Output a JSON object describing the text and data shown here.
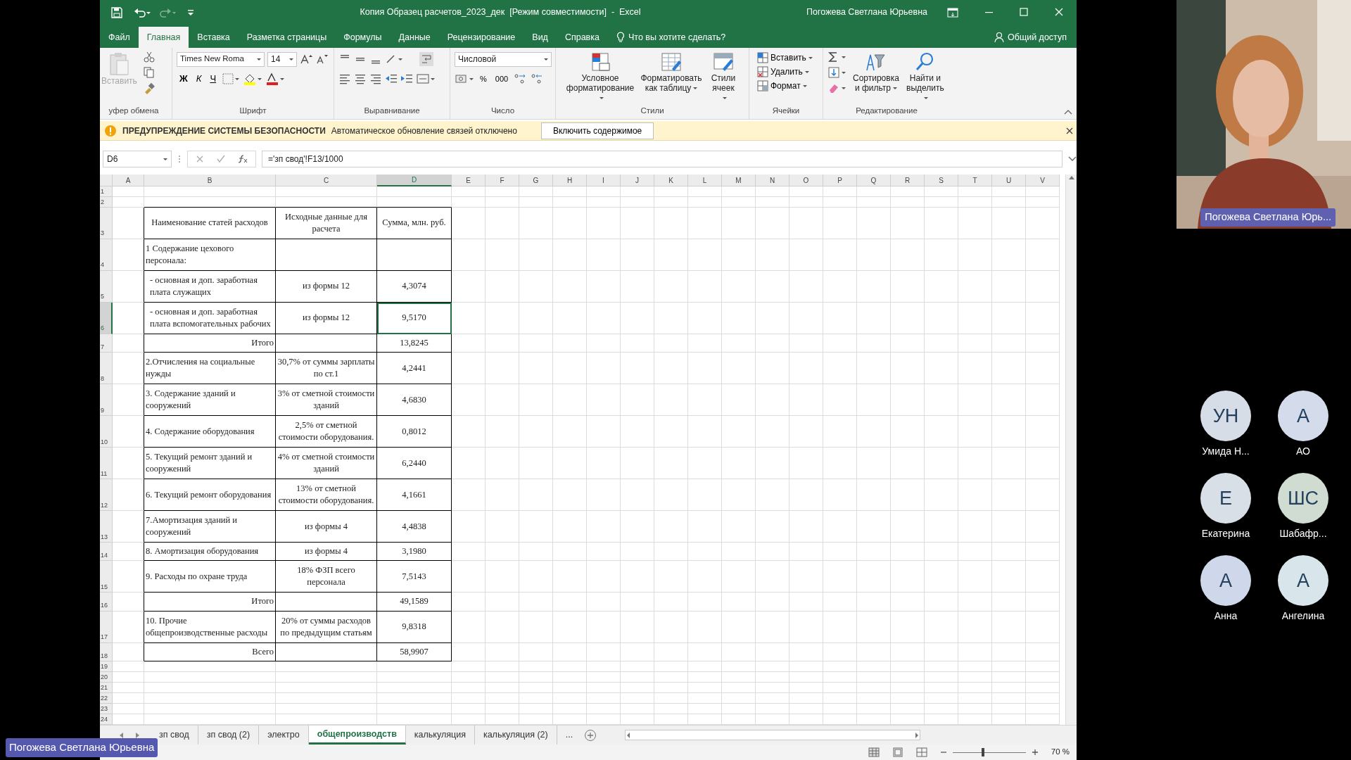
{
  "title_bar": {
    "title": "Копия Образец расчетов_2023_дек  [Режим совместимости]  -  Excel",
    "user": "Погожева Светлана Юрьевна"
  },
  "menu_tabs": [
    {
      "label": "Файл",
      "selected": false
    },
    {
      "label": "Главная",
      "selected": true
    },
    {
      "label": "Вставка",
      "selected": false
    },
    {
      "label": "Разметка страницы",
      "selected": false
    },
    {
      "label": "Формулы",
      "selected": false
    },
    {
      "label": "Данные",
      "selected": false
    },
    {
      "label": "Рецензирование",
      "selected": false
    },
    {
      "label": "Вид",
      "selected": false
    },
    {
      "label": "Справка",
      "selected": false
    }
  ],
  "tell_me": "Что вы хотите сделать?",
  "share": "Общий доступ",
  "ribbon": {
    "groups": [
      {
        "kind": "clipboard",
        "label": "уфер обмена",
        "paste": {
          "label": "Вставить",
          "disabled": true
        }
      },
      {
        "kind": "font",
        "label": "Шрифт",
        "font_name": "Times New Roma",
        "font_size": "14",
        "style_buttons": [
          {
            "label": "Ж",
            "kind": "bold"
          },
          {
            "label": "К",
            "kind": "italic"
          },
          {
            "label": "Ч",
            "kind": "underline"
          }
        ]
      },
      {
        "kind": "alignment",
        "label": "Выравнивание"
      },
      {
        "kind": "number",
        "label": "Число",
        "format": "Числовой",
        "buttons": [
          "%",
          "000"
        ]
      },
      {
        "kind": "styles",
        "label": "Стили",
        "buttons": [
          "Условное форматирование",
          "Форматировать как таблицу",
          "Стили ячеек"
        ]
      },
      {
        "kind": "cells",
        "label": "Ячейки",
        "buttons": [
          "Вставить",
          "Удалить",
          "Формат"
        ]
      },
      {
        "kind": "editing",
        "label": "Редактирование",
        "buttons": [
          "Сортировка и фильтр",
          "Найти и выделить"
        ]
      }
    ]
  },
  "security_bar": {
    "title": "ПРЕДУПРЕЖДЕНИЕ СИСТЕМЫ БЕЗОПАСНОСТИ",
    "message": "Автоматическое обновление связей отключено",
    "button": "Включить содержимое"
  },
  "formula_bar": {
    "name_box": "D6",
    "formula": "='зп свод'!F13/1000"
  },
  "sheet": {
    "columns": [
      {
        "label": "A",
        "selected": false
      },
      {
        "label": "B",
        "selected": false
      },
      {
        "label": "C",
        "selected": false
      },
      {
        "label": "D",
        "selected": true
      },
      {
        "label": "E",
        "selected": false
      },
      {
        "label": "F",
        "selected": false
      },
      {
        "label": "G",
        "selected": false
      },
      {
        "label": "H",
        "selected": false
      },
      {
        "label": "I",
        "selected": false
      },
      {
        "label": "J",
        "selected": false
      },
      {
        "label": "K",
        "selected": false
      },
      {
        "label": "L",
        "selected": false
      },
      {
        "label": "M",
        "selected": false
      },
      {
        "label": "N",
        "selected": false
      },
      {
        "label": "O",
        "selected": false
      },
      {
        "label": "P",
        "selected": false
      },
      {
        "label": "Q",
        "selected": false
      },
      {
        "label": "R",
        "selected": false
      },
      {
        "label": "S",
        "selected": false
      },
      {
        "label": "T",
        "selected": false
      },
      {
        "label": "U",
        "selected": false
      },
      {
        "label": "V",
        "selected": false
      }
    ],
    "rows": [
      {
        "number": "1",
        "selected": false,
        "kind": "empty"
      },
      {
        "number": "2",
        "selected": false,
        "kind": "empty"
      },
      {
        "number": "3",
        "selected": false,
        "kind": "header",
        "name": "Наименование статей расходов",
        "source": "Исходные данные для расчета",
        "amount": "Сумма, млн. руб."
      },
      {
        "number": "4",
        "selected": false,
        "kind": "item",
        "name": "1 Содержание цехового персонала:"
      },
      {
        "number": "5",
        "selected": false,
        "kind": "subitem",
        "name": "-  основная и доп. заработная плата служащих",
        "source": "из формы 12",
        "amount": "4,3074"
      },
      {
        "number": "6",
        "selected": true,
        "kind": "subitem",
        "name": "-  основная и доп. заработная плата вспомогательных рабочих",
        "source": "из формы 12",
        "amount": "9,5170"
      },
      {
        "number": "7",
        "selected": false,
        "kind": "total",
        "name": "Итого",
        "amount": "13,8245"
      },
      {
        "number": "8",
        "selected": false,
        "kind": "item",
        "name": "2.Отчисления на социальные нужды",
        "source": "30,7% от суммы зарплаты по ст.1",
        "amount": "4,2441"
      },
      {
        "number": "9",
        "selected": false,
        "kind": "item",
        "name": "3. Содержание зданий и сооружений",
        "source": "3% от сметной стоимости зданий",
        "amount": "4,6830"
      },
      {
        "number": "10",
        "selected": false,
        "kind": "item",
        "name": "4. Содержание оборудования",
        "source": "2,5% от сметной стоимости оборудования.",
        "amount": "0,8012"
      },
      {
        "number": "11",
        "selected": false,
        "kind": "item",
        "name": "5. Текущий ремонт зданий и сооружений",
        "source": "4% от сметной стоимости зданий",
        "amount": "6,2440"
      },
      {
        "number": "12",
        "selected": false,
        "kind": "item",
        "name": "6. Текущий ремонт оборудования",
        "source": "13% от сметной стоимости оборудования.",
        "amount": "4,1661"
      },
      {
        "number": "13",
        "selected": false,
        "kind": "item",
        "name": "7.Амортизация зданий и сооружений",
        "source": "из формы 4",
        "amount": "4,4838"
      },
      {
        "number": "14",
        "selected": false,
        "kind": "item",
        "name": "8. Амортизация оборудования",
        "source": "из формы 4",
        "amount": "3,1980"
      },
      {
        "number": "15",
        "selected": false,
        "kind": "item",
        "name": "9. Расходы по охране труда",
        "source": "18% ФЗП всего персонала",
        "amount": "7,5143"
      },
      {
        "number": "16",
        "selected": false,
        "kind": "total",
        "name": "Итого",
        "amount": "49,1589"
      },
      {
        "number": "17",
        "selected": false,
        "kind": "item",
        "name": "10. Прочие общепроизводственные расходы",
        "source": "20% от суммы расходов по предыдущим статьям",
        "amount": "9,8318"
      },
      {
        "number": "18",
        "selected": false,
        "kind": "total",
        "name": "Всего",
        "amount": "58,9907"
      },
      {
        "number": "19",
        "selected": false,
        "kind": "empty"
      },
      {
        "number": "20",
        "selected": false,
        "kind": "empty"
      },
      {
        "number": "21",
        "selected": false,
        "kind": "empty"
      },
      {
        "number": "22",
        "selected": false,
        "kind": "empty"
      },
      {
        "number": "23",
        "selected": false,
        "kind": "empty"
      },
      {
        "number": "24",
        "selected": false,
        "kind": "empty"
      }
    ]
  },
  "sheet_tabs": [
    {
      "label": "зп свод",
      "selected": false
    },
    {
      "label": "зп свод (2)",
      "selected": false
    },
    {
      "label": "электро",
      "selected": false
    },
    {
      "label": "общепроизводств",
      "selected": true
    },
    {
      "label": "калькуляция",
      "selected": false
    },
    {
      "label": "калькуляция (2)",
      "selected": false
    }
  ],
  "more_tabs": "...",
  "status_bar": {
    "zoom": "70 %",
    "zoom_slider": {
      "level": 0.4
    }
  },
  "meeting": {
    "presenter_video": {
      "kind": "picture",
      "name_tag": "Погожева Светлана Юрь..."
    },
    "participants": [
      {
        "initials": "УН",
        "name": "Умида Н...",
        "color": "#d6dde6"
      },
      {
        "initials": "А",
        "name": "АО",
        "color": "#d4dcec"
      },
      {
        "initials": "Е",
        "name": "Екатерина",
        "color": "#d8dfe6"
      },
      {
        "initials": "ШС",
        "name": "Шабафр...",
        "color": "#d0dcd2"
      },
      {
        "initials": "А",
        "name": "Анна",
        "color": "#cfd8ea"
      },
      {
        "initials": "А",
        "name": "Ангелина",
        "color": "#d8e6ec"
      }
    ],
    "presenter_label": "Погожева Светлана Юрьевна"
  }
}
